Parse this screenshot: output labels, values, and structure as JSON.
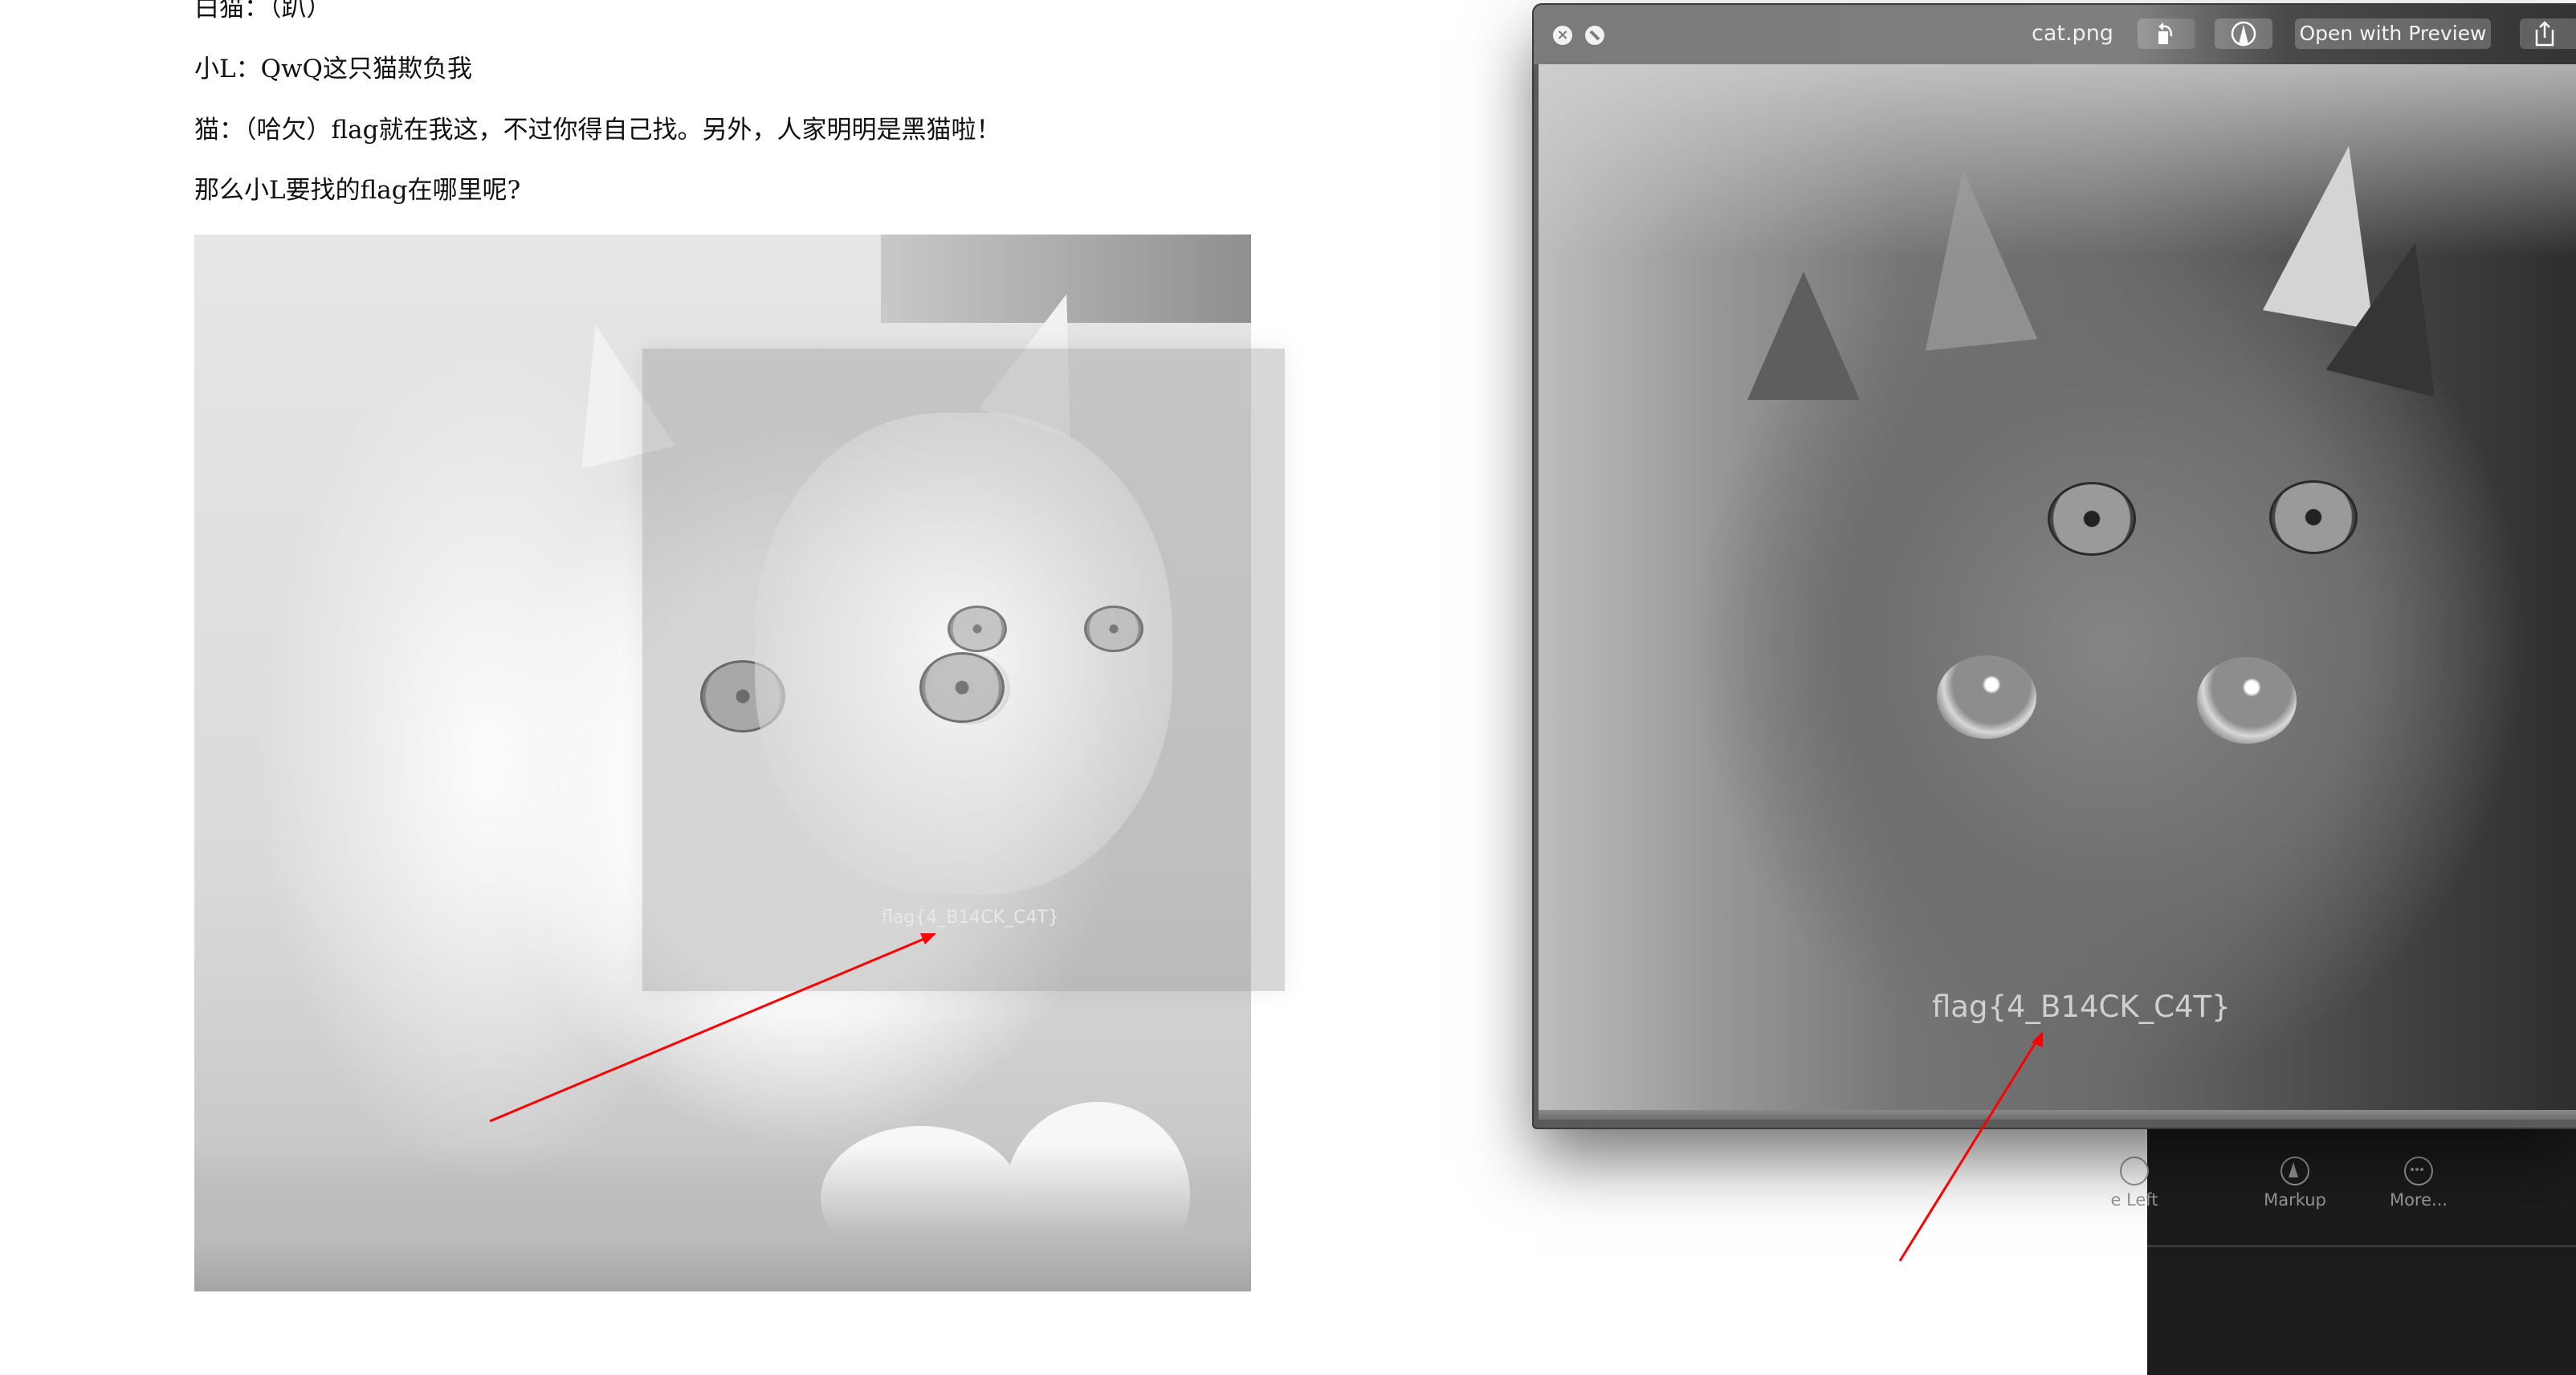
{
  "document": {
    "lines": [
      "白猫：（趴）",
      "小L：QwQ这只猫欺负我",
      "猫：（哈欠）flag就在我这，不过你得自己找。另外，人家明明是黑猫啦！",
      "那么小L要找的flag在哪里呢?"
    ],
    "image_flag_text": "flag{4_B14CK_C4T}"
  },
  "quicklook": {
    "title": "cat.png",
    "buttons": {
      "close_icon": "close-icon",
      "fullscreen_icon": "fullscreen-icon",
      "rotate_icon": "rotate-left-icon",
      "markup_icon": "markup-icon",
      "open_with_preview": "Open with Preview",
      "share_icon": "share-icon"
    },
    "image_flag_text": "flag{4_B14CK_C4T}"
  },
  "side_panel": {
    "items": [
      {
        "label": "e Left",
        "icon": "rotate-left-icon"
      },
      {
        "label": "Markup",
        "icon": "markup-icon"
      },
      {
        "label": "More...",
        "icon": "more-icon"
      }
    ]
  },
  "annotations": {
    "arrow_color": "#ff0000"
  }
}
